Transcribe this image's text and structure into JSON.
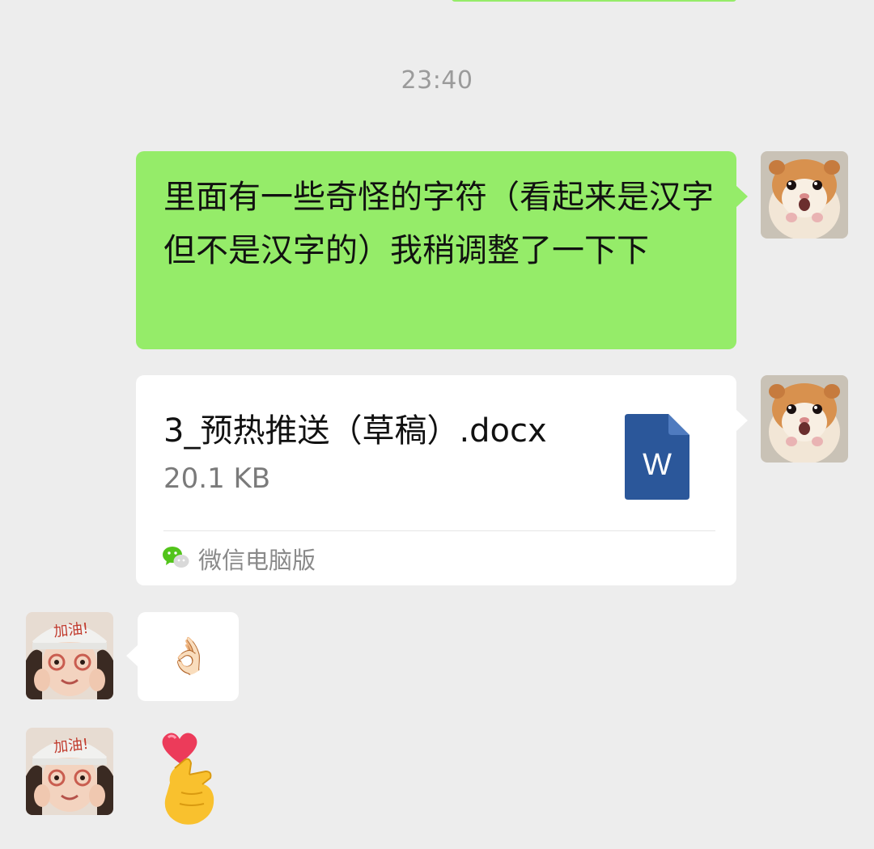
{
  "timestamp": "23:40",
  "messages": {
    "text_message": "里面有一些奇怪的字符（看起来是汉字但不是汉字的）我稍调整了一下下",
    "file": {
      "name": "3_预热推送（草稿）.docx",
      "size": "20.1 KB",
      "source": "微信电脑版",
      "icon_letter": "W"
    },
    "reply_emoji": "👌🏻",
    "reaction_icon": "heart-hand-icon"
  },
  "avatars": {
    "me": "hamster-avatar",
    "friend": "girl-avatar",
    "friend_cap_text": "加油!"
  },
  "colors": {
    "my_bubble": "#95ec69",
    "their_bubble": "#ffffff",
    "background": "#ededed",
    "word_blue": "#2b579a"
  }
}
